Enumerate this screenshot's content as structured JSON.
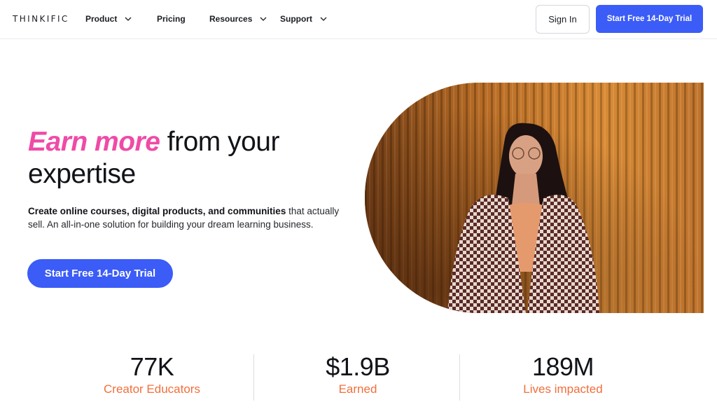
{
  "nav": {
    "logo": "THINKIFIC",
    "items": [
      {
        "label": "Product",
        "dropdown": true
      },
      {
        "label": "Pricing",
        "dropdown": false
      },
      {
        "label": "Resources",
        "dropdown": true
      },
      {
        "label": "Support",
        "dropdown": true
      }
    ],
    "signin_label": "Sign In",
    "trial_label": "Start Free 14-Day Trial"
  },
  "hero": {
    "headline_accent": "Earn more",
    "headline_rest": "from your",
    "headline_line2": "expertise",
    "sub_bold": "Create online courses, digital products, and communities",
    "sub_rest": "that actually sell. An all-in-one solution for building your dream learning business.",
    "cta_label": "Start Free 14-Day Trial"
  },
  "stats": [
    {
      "value": "77K",
      "label": "Creator Educators"
    },
    {
      "value": "$1.9B",
      "label": "Earned"
    },
    {
      "value": "189M",
      "label": "Lives impacted"
    }
  ],
  "colors": {
    "primary": "#3b5cf6",
    "accent_pink": "#ef4ba6",
    "stat_label": "#f06f3c"
  }
}
